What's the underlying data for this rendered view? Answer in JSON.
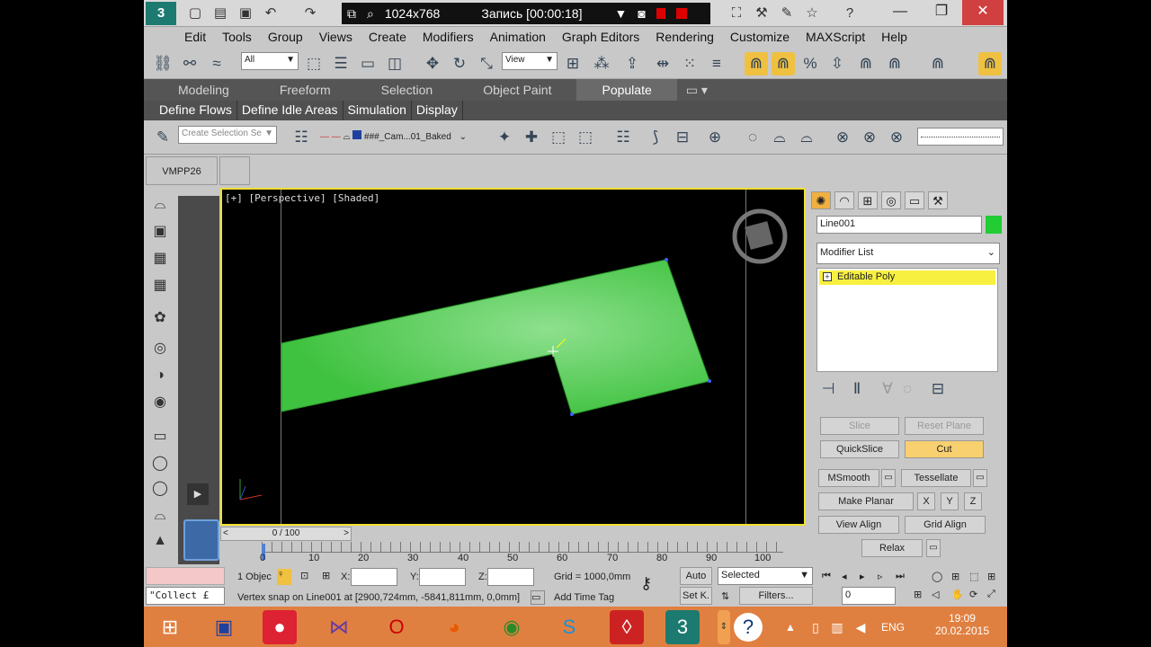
{
  "recorder": {
    "resolution": "1024x768",
    "status": "Запись [00:00:18]"
  },
  "menu": [
    "Edit",
    "Tools",
    "Group",
    "Views",
    "Create",
    "Modifiers",
    "Animation",
    "Graph Editors",
    "Rendering",
    "Customize",
    "MAXScript",
    "Help"
  ],
  "toolbar": {
    "selection_filter": "All",
    "ref_coord": "View"
  },
  "ribbon": {
    "tabs": [
      "Modeling",
      "Freeform",
      "Selection",
      "Object Paint",
      "Populate"
    ],
    "active_tab": "Populate",
    "subtabs": [
      "Define Flows",
      "Define Idle Areas",
      "Simulation",
      "Display"
    ],
    "selection_set_placeholder": "Create Selection Se",
    "layer": "###_Cam...01_Baked"
  },
  "panel": {
    "tab": "VMPP26"
  },
  "viewport": {
    "label": "[+] [Perspective] [Shaded]"
  },
  "command_panel": {
    "object_name": "Line001",
    "object_color": "#22cc33",
    "modifier_list": "Modifier List",
    "stack_item": "Editable Poly",
    "buttons": {
      "slice": "Slice",
      "reset_plane": "Reset Plane",
      "quickslice": "QuickSlice",
      "cut": "Cut",
      "msmooth": "MSmooth",
      "tessellate": "Tessellate",
      "make_planar": "Make Planar",
      "x": "X",
      "y": "Y",
      "z": "Z",
      "view_align": "View Align",
      "grid_align": "Grid Align",
      "relax": "Relax"
    }
  },
  "timeline": {
    "slider": "0 / 100",
    "ticks": [
      "0",
      "10",
      "20",
      "30",
      "40",
      "50",
      "60",
      "70",
      "80",
      "90",
      "100"
    ]
  },
  "status": {
    "maxscript": "\"Collect £",
    "selected": "1 Objec",
    "x_label": "X:",
    "y_label": "Y:",
    "z_label": "Z:",
    "grid": "Grid = 1000,0mm",
    "prompt": "Vertex snap on Line001 at [2900,724mm, -5841,811mm, 0,0mm]",
    "add_time_tag": "Add Time Tag",
    "auto": "Auto",
    "set_key": "Set K.",
    "key_mode": "Selected",
    "filters": "Filters...",
    "frame": "0"
  },
  "tray": {
    "lang": "ENG",
    "time": "19:09",
    "date": "20.02.2015"
  }
}
